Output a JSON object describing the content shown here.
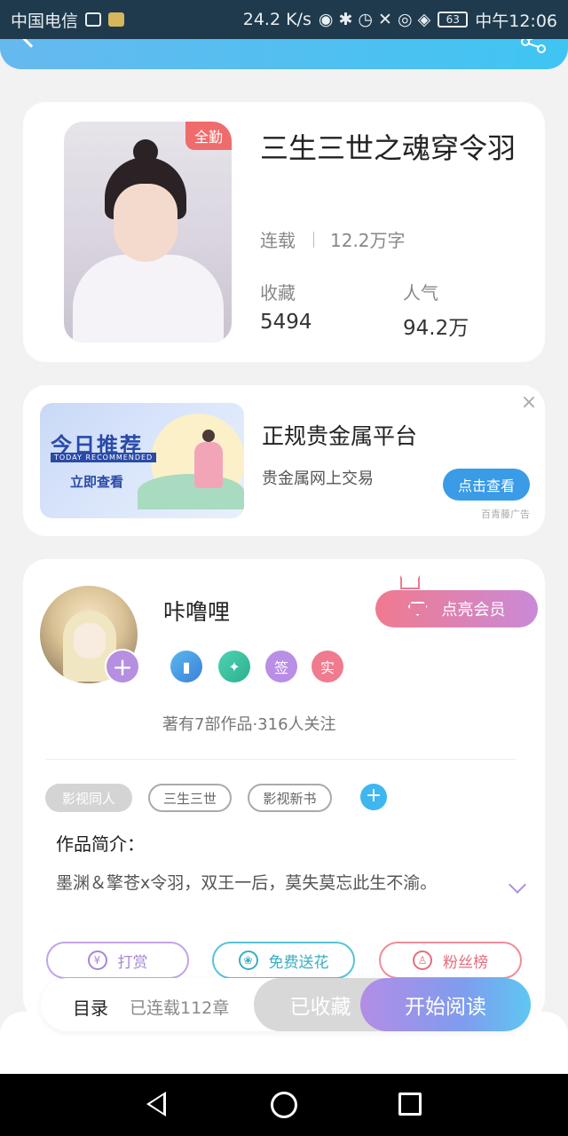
{
  "status_bar": {
    "carrier": "中国电信",
    "speed": "24.2 K/s",
    "battery": "63",
    "time": "中午12:06"
  },
  "book": {
    "tag": "全勤",
    "title": "三生三世之魂穿令羽",
    "status": "连载",
    "word_count": "12.2万字",
    "favorites_label": "收藏",
    "favorites_value": "5494",
    "popularity_label": "人气",
    "popularity_value": "94.2万"
  },
  "ad": {
    "image_title": "今日推荐",
    "image_subtitle": "TODAY RECOMMENDED",
    "image_cta": "立即查看",
    "title": "正规贵金属平台",
    "subtitle": "贵金属网上交易",
    "button": "点击查看",
    "close": "×",
    "source": "百青藤广告"
  },
  "author": {
    "name": "咔噜哩",
    "vip_button": "点亮会员",
    "badges": [
      "",
      "",
      "签",
      "实"
    ],
    "stats": "著有7部作品·316人关注",
    "tags": [
      "影视同人",
      "三生三世",
      "影视新书"
    ],
    "intro_label": "作品简介：",
    "intro_text": "墨渊＆擎苍x令羽，双王一后，莫失莫忘此生不渝。",
    "actions": [
      {
        "label": "打赏",
        "icon": "¥"
      },
      {
        "label": "免费送花",
        "icon": "❀"
      },
      {
        "label": "粉丝榜",
        "icon": "♙"
      }
    ]
  },
  "bottom_bar": {
    "toc_label": "目录",
    "toc_count": "已连载112章",
    "collected": "已收藏",
    "read": "开始阅读"
  },
  "colors": {
    "accent_blue": "#3fc5f2",
    "vip_pink": "#f07a8e",
    "purple": "#b68fe0"
  }
}
